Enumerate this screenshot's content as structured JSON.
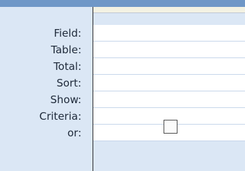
{
  "query_grid": {
    "rows": [
      {
        "label": "Field:"
      },
      {
        "label": "Table:"
      },
      {
        "label": "Total:"
      },
      {
        "label": "Sort:"
      },
      {
        "label": "Show:"
      },
      {
        "label": "Criteria:"
      },
      {
        "label": "or:"
      }
    ],
    "field_dropdown": {
      "icon": "chevron-down-icon"
    },
    "show_checkbox": {
      "checked": false
    }
  }
}
